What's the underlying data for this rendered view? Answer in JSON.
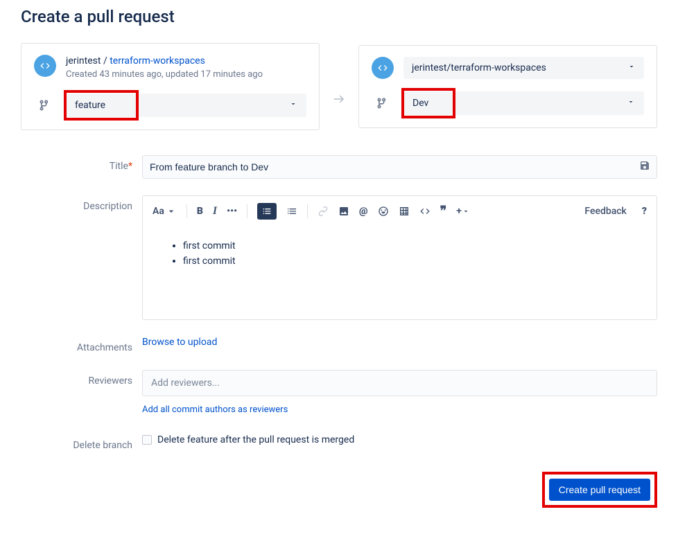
{
  "page_title": "Create a pull request",
  "source": {
    "owner": "jerintest",
    "repo": "terraform-workspaces",
    "created": "Created 43 minutes ago, updated 17 minutes ago",
    "branch": "feature"
  },
  "destination": {
    "repo": "jerintest/terraform-workspaces",
    "branch": "Dev"
  },
  "form": {
    "title_label": "Title",
    "title_value": "From feature branch to Dev",
    "description_label": "Description",
    "toolbar": {
      "text_style": "Aa",
      "feedback": "Feedback",
      "help": "?"
    },
    "description_items": [
      "first commit",
      "first commit"
    ],
    "attachments_label": "Attachments",
    "attachments_action": "Browse to upload",
    "reviewers_label": "Reviewers",
    "reviewers_placeholder": "Add reviewers...",
    "reviewers_sublink": "Add all commit authors as reviewers",
    "delete_branch_label": "Delete branch",
    "delete_branch_text": "Delete feature after the pull request is merged"
  },
  "actions": {
    "create": "Create pull request"
  }
}
